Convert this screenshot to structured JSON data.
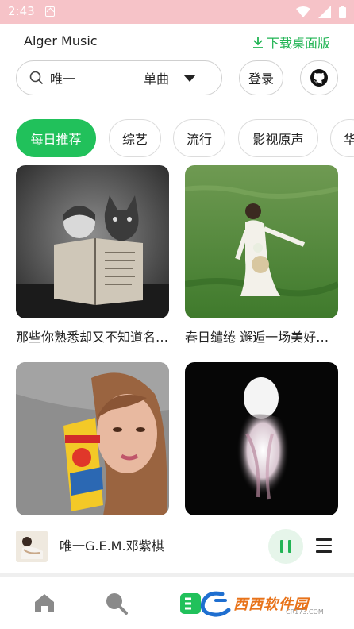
{
  "status_bar": {
    "time": "2:43"
  },
  "header": {
    "app_title": "Alger Music",
    "download_label": "下载桌面版"
  },
  "search": {
    "query": "唯一",
    "type_label": "单曲"
  },
  "actions": {
    "login_label": "登录"
  },
  "categories": [
    {
      "label": "每日推荐",
      "active": true
    },
    {
      "label": "综艺",
      "active": false
    },
    {
      "label": "流行",
      "active": false
    },
    {
      "label": "影视原声",
      "active": false
    },
    {
      "label": "华",
      "active": false
    }
  ],
  "playlists": [
    {
      "caption": "那些你熟悉却又不知道名字的歌"
    },
    {
      "caption": "春日缱绻 邂逅一场美好的相遇"
    },
    {
      "caption": ""
    },
    {
      "caption": ""
    }
  ],
  "player": {
    "track": "唯一G.E.M.邓紫棋",
    "state": "playing"
  },
  "nav": [
    {
      "icon": "home-icon"
    },
    {
      "icon": "search-icon"
    },
    {
      "icon": "list-icon"
    }
  ],
  "watermark": {
    "text": "西西软件园",
    "sub": "CR173.COM"
  },
  "colors": {
    "accent": "#21c15b",
    "status_bar": "#f6c3c8"
  }
}
